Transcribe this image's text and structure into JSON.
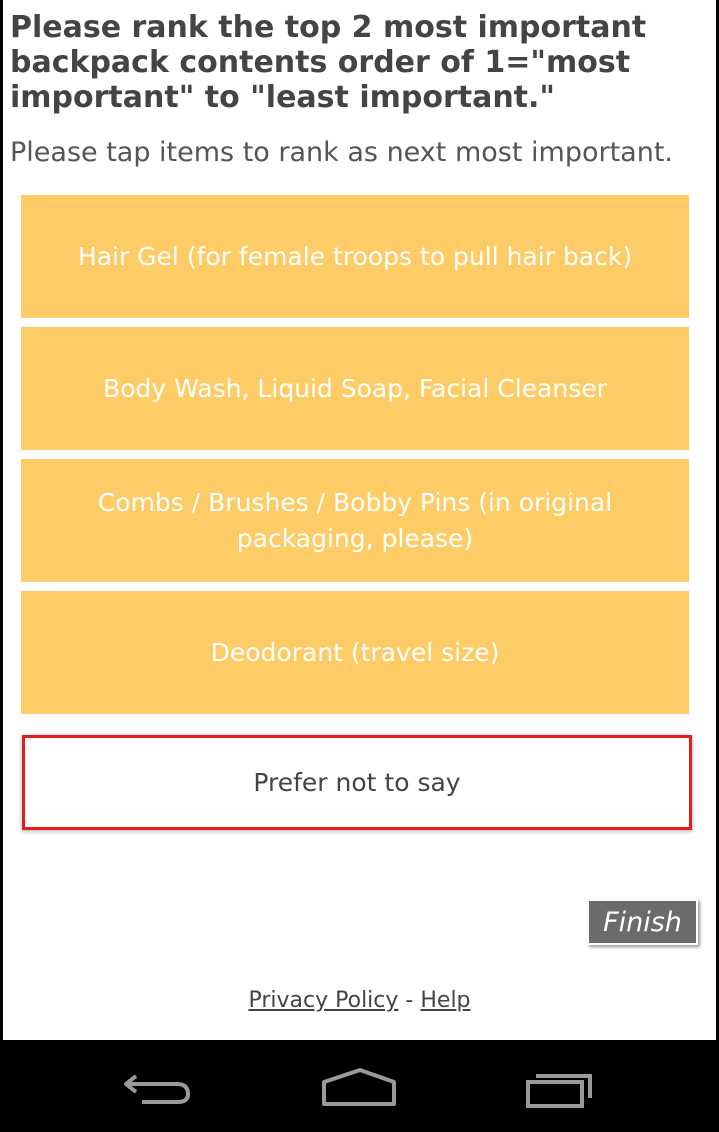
{
  "question": {
    "title": "Please rank the top 2 most important backpack contents order of 1=\"most important\" to \"least important.\"",
    "instruction": "Please tap items to rank as next most important."
  },
  "options": [
    {
      "label": "Hair Gel (for female troops to pull hair back)"
    },
    {
      "label": "Body Wash, Liquid Soap, Facial Cleanser"
    },
    {
      "label": "Combs / Brushes / Bobby Pins (in original packaging, please)"
    },
    {
      "label": "Deodorant (travel size)"
    }
  ],
  "prefer_not": {
    "label": "Prefer not to say"
  },
  "finish_label": "Finish",
  "footer": {
    "privacy": "Privacy Policy",
    "separator": " - ",
    "help": "Help"
  },
  "colors": {
    "option_bg": "#fecc66",
    "highlight_border": "#e31c1c",
    "finish_bg": "#6b6b6b"
  },
  "nav_icons": [
    "back-icon",
    "home-icon",
    "recent-apps-icon"
  ]
}
